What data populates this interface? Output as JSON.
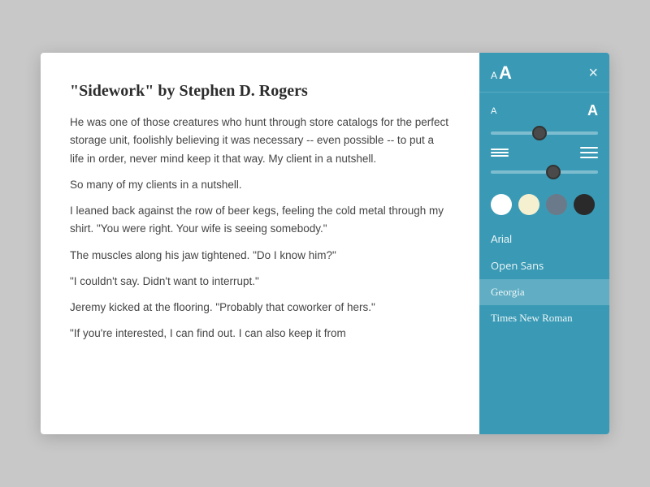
{
  "reading": {
    "title": "\"Sidework\" by Stephen D. Rogers",
    "paragraphs": [
      "He was one of those creatures who hunt through store catalogs for the perfect storage unit, foolishly believing it was necessary -- even possible -- to put a life in order, never mind keep it that way. My client in a nutshell.",
      "So many of my clients in a nutshell.",
      "I leaned back against the row of beer kegs, feeling the cold metal through my shirt. \"You were right. Your wife is seeing somebody.\"",
      "The muscles along his jaw tightened. \"Do I know him?\"",
      "\"I couldn't say. Didn't want to interrupt.\"",
      "Jeremy kicked at the flooring. \"Probably that coworker of hers.\"",
      "\"If you're interested, I can find out. I can also keep it from"
    ]
  },
  "settings": {
    "close_label": "×",
    "font_size_small": "A",
    "font_size_large": "A",
    "font_size_value": 45,
    "line_spacing_value": 60,
    "colors": [
      {
        "name": "white",
        "hex": "#ffffff",
        "selected": false
      },
      {
        "name": "cream",
        "hex": "#f5f0d0",
        "selected": false
      },
      {
        "name": "gray",
        "hex": "#6b7a8a",
        "selected": false
      },
      {
        "name": "dark",
        "hex": "#2a2a2a",
        "selected": false
      }
    ],
    "fonts": [
      {
        "name": "Arial",
        "selected": false
      },
      {
        "name": "Open Sans",
        "selected": false
      },
      {
        "name": "Georgia",
        "selected": true
      },
      {
        "name": "Times New Roman",
        "selected": false
      }
    ]
  }
}
